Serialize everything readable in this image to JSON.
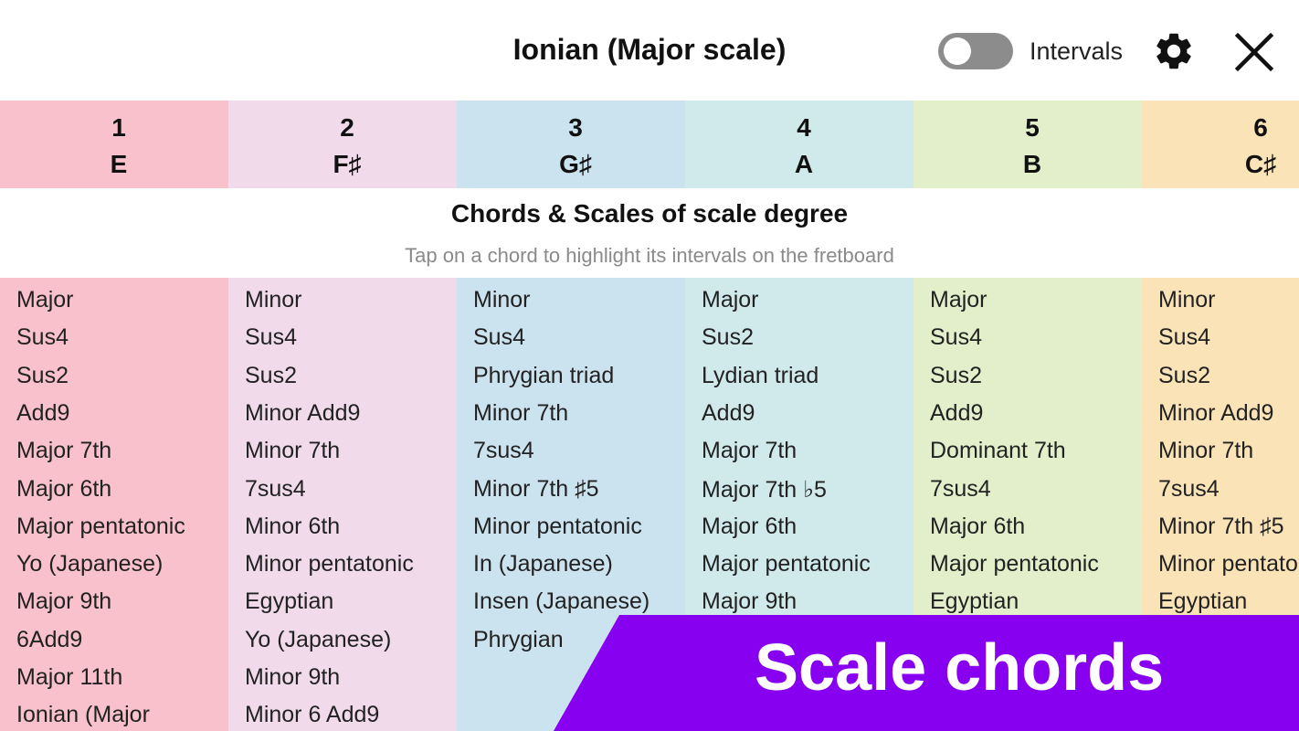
{
  "header": {
    "title": "Ionian (Major scale)",
    "toggle_label": "Intervals",
    "toggle_on": false,
    "settings_icon": "gear-icon",
    "close_icon": "close-icon"
  },
  "colors": {
    "col1": "#f8c1cb",
    "col2": "#f1dbea",
    "col3": "#cbe2ef",
    "col4": "#d0e9ea",
    "col5": "#e3efca",
    "col6": "#fbe3b8",
    "banner": "#8800f0"
  },
  "degrees": [
    {
      "number": "1",
      "note": "E"
    },
    {
      "number": "2",
      "note": "F♯"
    },
    {
      "number": "3",
      "note": "G♯"
    },
    {
      "number": "4",
      "note": "A"
    },
    {
      "number": "5",
      "note": "B"
    },
    {
      "number": "6",
      "note": "C♯"
    }
  ],
  "section": {
    "title": "Chords & Scales of scale degree",
    "subtitle": "Tap on a chord to highlight its intervals on the fretboard"
  },
  "chords": [
    [
      "Major",
      "Sus4",
      "Sus2",
      "Add9",
      "Major 7th",
      "Major 6th",
      "Major pentatonic",
      "Yo (Japanese)",
      "Major 9th",
      "6Add9",
      "Major 11th",
      "Ionian (Major"
    ],
    [
      "Minor",
      "Sus4",
      "Sus2",
      "Minor Add9",
      "Minor 7th",
      "7sus4",
      "Minor 6th",
      "Minor pentatonic",
      "Egyptian",
      "Yo (Japanese)",
      "Minor 9th",
      "Minor 6 Add9"
    ],
    [
      "Minor",
      "Sus4",
      "Phrygian triad",
      "Minor 7th",
      "7sus4",
      "Minor 7th ♯5",
      "Minor pentatonic",
      "In (Japanese)",
      "Insen (Japanese)",
      "Phrygian"
    ],
    [
      "Major",
      "Sus2",
      "Lydian triad",
      "Add9",
      "Major 7th",
      "Major 7th ♭5",
      "Major 6th",
      "Major pentatonic",
      "Major 9th"
    ],
    [
      "Major",
      "Sus4",
      "Sus2",
      "Add9",
      "Dominant 7th",
      "7sus4",
      "Major 6th",
      "Major pentatonic",
      "Egyptian"
    ],
    [
      "Minor",
      "Sus4",
      "Sus2",
      "Minor Add9",
      "Minor 7th",
      "7sus4",
      "Minor 7th ♯5",
      "Minor pentatonic",
      "Egyptian"
    ]
  ],
  "banner": {
    "text": "Scale chords"
  }
}
